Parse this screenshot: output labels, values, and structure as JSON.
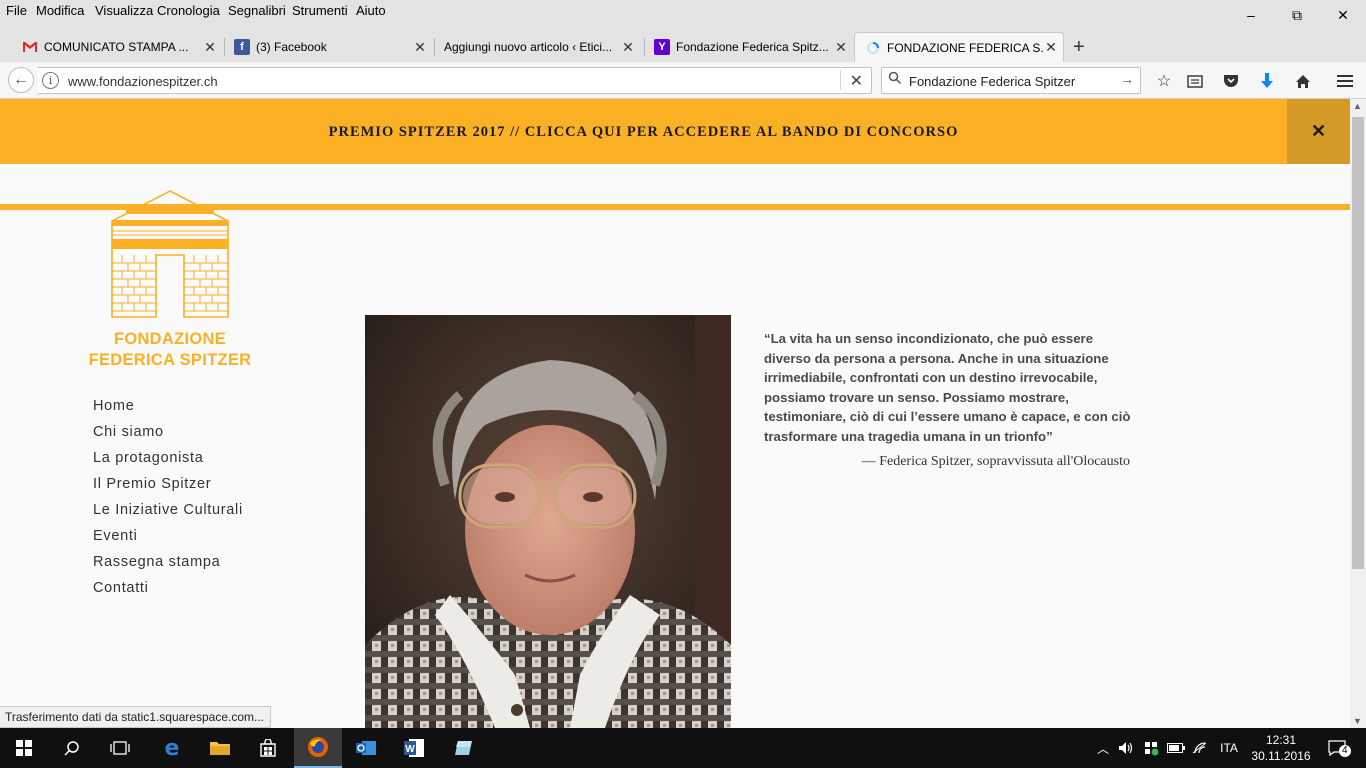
{
  "menu": [
    {
      "label": "File"
    },
    {
      "label": "Modifica"
    },
    {
      "label": "Visualizza"
    },
    {
      "label": "Cronologia"
    },
    {
      "label": "Segnalibri"
    },
    {
      "label": "Strumenti"
    },
    {
      "label": "Aiuto"
    }
  ],
  "window_controls": {
    "minimize": "–",
    "maximize": "⧉",
    "close": "✕"
  },
  "tabs": [
    {
      "title": "COMUNICATO STAMPA ...",
      "icon": "gmail-icon",
      "active": false
    },
    {
      "title": "(3) Facebook",
      "icon": "facebook-icon",
      "active": false
    },
    {
      "title": "Aggiungi nuovo articolo ‹ Etici...",
      "icon": "none",
      "active": false
    },
    {
      "title": "Fondazione Federica Spitz...",
      "icon": "yahoo-icon",
      "active": false
    },
    {
      "title": "FONDAZIONE FEDERICA S...",
      "icon": "loading-icon",
      "active": true
    }
  ],
  "tab_close_glyph": "✕",
  "new_tab_glyph": "+",
  "navbar": {
    "url": "www.fondazionespitzer.ch",
    "search_value": "Fondazione Federica Spitzer"
  },
  "banner": {
    "text": "PREMIO SPITZER 2017 // CLICCA QUI PER ACCEDERE AL BANDO DI CONCORSO",
    "close": "✕",
    "color": "#fbb025"
  },
  "logo": {
    "line1": "FONDAZIONE",
    "line2": "FEDERICA SPITZER",
    "color": "#fbb025"
  },
  "nav": [
    {
      "label": "Home"
    },
    {
      "label": "Chi siamo"
    },
    {
      "label": "La protagonista"
    },
    {
      "label": "Il Premio Spitzer"
    },
    {
      "label": "Le Iniziative Culturali"
    },
    {
      "label": "Eventi"
    },
    {
      "label": "Rassegna stampa"
    },
    {
      "label": "Contatti"
    }
  ],
  "quote": {
    "text": "“La vita ha un senso incondizionato, che può essere diverso da persona a persona. Anche in una situazione irrimediabile, confrontati con un destino irrevocabile, possiamo trovare un senso. Possiamo mostrare, testimoniare, ciò di cui l’essere umano è capace, e con ciò trasformare una tragedia umana in un trionfo”",
    "attribution": "— Federica Spitzer, sopravvissuta all'Olocausto"
  },
  "status_text": "Trasferimento dati da static1.squarespace.com...",
  "taskbar": {
    "language": "ITA",
    "time": "12:31",
    "date": "30.11.2016",
    "notifications": "4"
  }
}
